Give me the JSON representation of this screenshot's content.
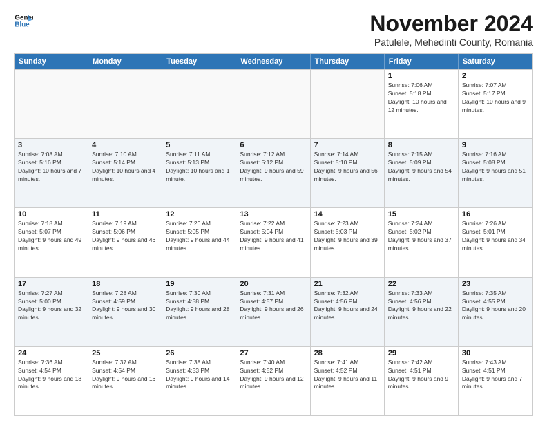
{
  "header": {
    "logo_line1": "General",
    "logo_line2": "Blue",
    "title": "November 2024",
    "subtitle": "Patulele, Mehedinti County, Romania"
  },
  "weekdays": [
    "Sunday",
    "Monday",
    "Tuesday",
    "Wednesday",
    "Thursday",
    "Friday",
    "Saturday"
  ],
  "rows": [
    [
      {
        "day": "",
        "empty": true,
        "text": ""
      },
      {
        "day": "",
        "empty": true,
        "text": ""
      },
      {
        "day": "",
        "empty": true,
        "text": ""
      },
      {
        "day": "",
        "empty": true,
        "text": ""
      },
      {
        "day": "",
        "empty": true,
        "text": ""
      },
      {
        "day": "1",
        "text": "Sunrise: 7:06 AM\nSunset: 5:18 PM\nDaylight: 10 hours and 12 minutes."
      },
      {
        "day": "2",
        "text": "Sunrise: 7:07 AM\nSunset: 5:17 PM\nDaylight: 10 hours and 9 minutes."
      }
    ],
    [
      {
        "day": "3",
        "text": "Sunrise: 7:08 AM\nSunset: 5:16 PM\nDaylight: 10 hours and 7 minutes."
      },
      {
        "day": "4",
        "text": "Sunrise: 7:10 AM\nSunset: 5:14 PM\nDaylight: 10 hours and 4 minutes."
      },
      {
        "day": "5",
        "text": "Sunrise: 7:11 AM\nSunset: 5:13 PM\nDaylight: 10 hours and 1 minute."
      },
      {
        "day": "6",
        "text": "Sunrise: 7:12 AM\nSunset: 5:12 PM\nDaylight: 9 hours and 59 minutes."
      },
      {
        "day": "7",
        "text": "Sunrise: 7:14 AM\nSunset: 5:10 PM\nDaylight: 9 hours and 56 minutes."
      },
      {
        "day": "8",
        "text": "Sunrise: 7:15 AM\nSunset: 5:09 PM\nDaylight: 9 hours and 54 minutes."
      },
      {
        "day": "9",
        "text": "Sunrise: 7:16 AM\nSunset: 5:08 PM\nDaylight: 9 hours and 51 minutes."
      }
    ],
    [
      {
        "day": "10",
        "text": "Sunrise: 7:18 AM\nSunset: 5:07 PM\nDaylight: 9 hours and 49 minutes."
      },
      {
        "day": "11",
        "text": "Sunrise: 7:19 AM\nSunset: 5:06 PM\nDaylight: 9 hours and 46 minutes."
      },
      {
        "day": "12",
        "text": "Sunrise: 7:20 AM\nSunset: 5:05 PM\nDaylight: 9 hours and 44 minutes."
      },
      {
        "day": "13",
        "text": "Sunrise: 7:22 AM\nSunset: 5:04 PM\nDaylight: 9 hours and 41 minutes."
      },
      {
        "day": "14",
        "text": "Sunrise: 7:23 AM\nSunset: 5:03 PM\nDaylight: 9 hours and 39 minutes."
      },
      {
        "day": "15",
        "text": "Sunrise: 7:24 AM\nSunset: 5:02 PM\nDaylight: 9 hours and 37 minutes."
      },
      {
        "day": "16",
        "text": "Sunrise: 7:26 AM\nSunset: 5:01 PM\nDaylight: 9 hours and 34 minutes."
      }
    ],
    [
      {
        "day": "17",
        "text": "Sunrise: 7:27 AM\nSunset: 5:00 PM\nDaylight: 9 hours and 32 minutes."
      },
      {
        "day": "18",
        "text": "Sunrise: 7:28 AM\nSunset: 4:59 PM\nDaylight: 9 hours and 30 minutes."
      },
      {
        "day": "19",
        "text": "Sunrise: 7:30 AM\nSunset: 4:58 PM\nDaylight: 9 hours and 28 minutes."
      },
      {
        "day": "20",
        "text": "Sunrise: 7:31 AM\nSunset: 4:57 PM\nDaylight: 9 hours and 26 minutes."
      },
      {
        "day": "21",
        "text": "Sunrise: 7:32 AM\nSunset: 4:56 PM\nDaylight: 9 hours and 24 minutes."
      },
      {
        "day": "22",
        "text": "Sunrise: 7:33 AM\nSunset: 4:56 PM\nDaylight: 9 hours and 22 minutes."
      },
      {
        "day": "23",
        "text": "Sunrise: 7:35 AM\nSunset: 4:55 PM\nDaylight: 9 hours and 20 minutes."
      }
    ],
    [
      {
        "day": "24",
        "text": "Sunrise: 7:36 AM\nSunset: 4:54 PM\nDaylight: 9 hours and 18 minutes."
      },
      {
        "day": "25",
        "text": "Sunrise: 7:37 AM\nSunset: 4:54 PM\nDaylight: 9 hours and 16 minutes."
      },
      {
        "day": "26",
        "text": "Sunrise: 7:38 AM\nSunset: 4:53 PM\nDaylight: 9 hours and 14 minutes."
      },
      {
        "day": "27",
        "text": "Sunrise: 7:40 AM\nSunset: 4:52 PM\nDaylight: 9 hours and 12 minutes."
      },
      {
        "day": "28",
        "text": "Sunrise: 7:41 AM\nSunset: 4:52 PM\nDaylight: 9 hours and 11 minutes."
      },
      {
        "day": "29",
        "text": "Sunrise: 7:42 AM\nSunset: 4:51 PM\nDaylight: 9 hours and 9 minutes."
      },
      {
        "day": "30",
        "text": "Sunrise: 7:43 AM\nSunset: 4:51 PM\nDaylight: 9 hours and 7 minutes."
      }
    ]
  ]
}
